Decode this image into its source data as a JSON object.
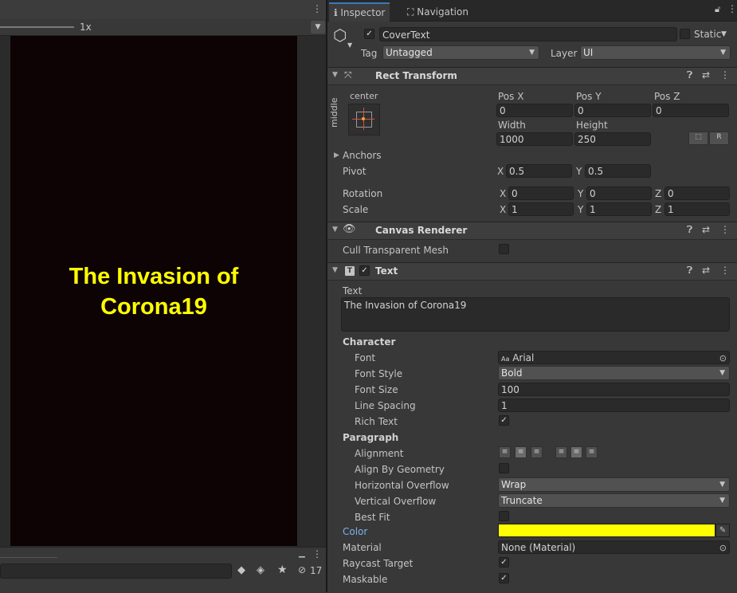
{
  "left": {
    "zoom_label": "1x",
    "canvas_text": "The Invasion of Corona19",
    "hidden_count": "17"
  },
  "tabs": [
    {
      "label": "Inspector",
      "icon": "info-icon",
      "active": true
    },
    {
      "label": "Navigation",
      "icon": "navigation-icon",
      "active": false
    }
  ],
  "object": {
    "name": "CoverText",
    "static_label": "Static",
    "tag_label": "Tag",
    "tag_value": "Untagged",
    "layer_label": "Layer",
    "layer_value": "UI"
  },
  "rect_transform": {
    "title": "Rect Transform",
    "anchor_h": "center",
    "anchor_v": "middle",
    "pos_x_label": "Pos X",
    "pos_x": "0",
    "pos_y_label": "Pos Y",
    "pos_y": "0",
    "pos_z_label": "Pos Z",
    "pos_z": "0",
    "width_label": "Width",
    "width": "1000",
    "height_label": "Height",
    "height": "250",
    "r_button": "R",
    "anchors_label": "Anchors",
    "pivot_label": "Pivot",
    "pivot_x": "0.5",
    "pivot_y": "0.5",
    "rotation_label": "Rotation",
    "rot_x": "0",
    "rot_y": "0",
    "rot_z": "0",
    "scale_label": "Scale",
    "scale_x": "1",
    "scale_y": "1",
    "scale_z": "1",
    "x": "X",
    "y": "Y",
    "z": "Z"
  },
  "canvas_renderer": {
    "title": "Canvas Renderer",
    "cull_label": "Cull Transparent Mesh"
  },
  "text_comp": {
    "title": "Text",
    "text_label": "Text",
    "text_value": "The Invasion of Corona19",
    "character_label": "Character",
    "font_label": "Font",
    "font_value": "Arial",
    "font_style_label": "Font Style",
    "font_style_value": "Bold",
    "font_size_label": "Font Size",
    "font_size_value": "100",
    "line_spacing_label": "Line Spacing",
    "line_spacing_value": "1",
    "rich_text_label": "Rich Text",
    "paragraph_label": "Paragraph",
    "alignment_label": "Alignment",
    "align_geom_label": "Align By Geometry",
    "h_overflow_label": "Horizontal Overflow",
    "h_overflow_value": "Wrap",
    "v_overflow_label": "Vertical Overflow",
    "v_overflow_value": "Truncate",
    "best_fit_label": "Best Fit",
    "color_label": "Color",
    "color_value": "#ffff00",
    "material_label": "Material",
    "material_value": "None (Material)",
    "raycast_label": "Raycast Target",
    "maskable_label": "Maskable"
  }
}
